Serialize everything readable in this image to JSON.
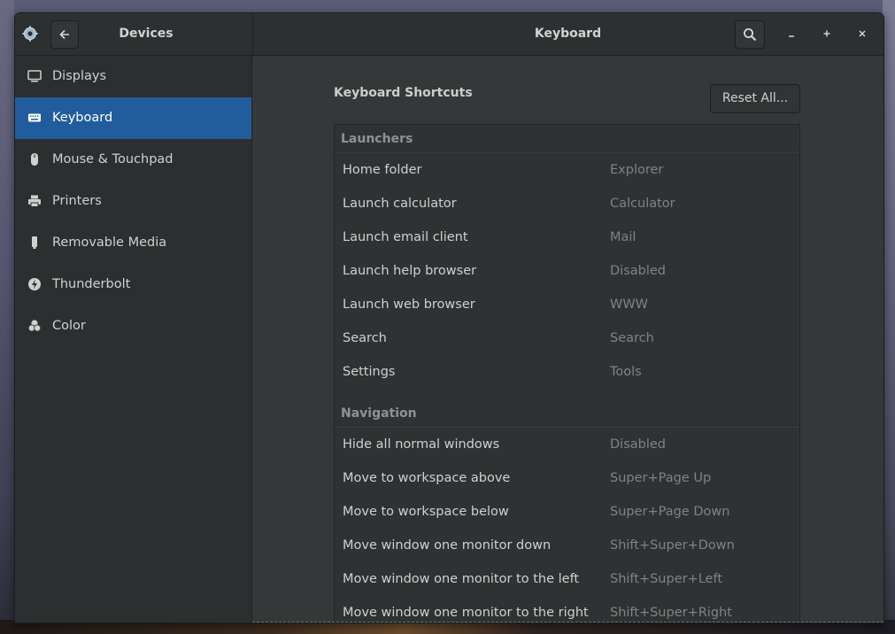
{
  "window": {
    "sidebar_title": "Devices",
    "title": "Keyboard"
  },
  "sidebar": {
    "items": [
      {
        "label": "Displays",
        "icon": "display-icon"
      },
      {
        "label": "Keyboard",
        "icon": "keyboard-icon",
        "active": true
      },
      {
        "label": "Mouse & Touchpad",
        "icon": "mouse-icon"
      },
      {
        "label": "Printers",
        "icon": "printer-icon"
      },
      {
        "label": "Removable Media",
        "icon": "usb-media-icon"
      },
      {
        "label": "Thunderbolt",
        "icon": "thunderbolt-icon"
      },
      {
        "label": "Color",
        "icon": "color-icon"
      }
    ]
  },
  "main": {
    "section_title": "Keyboard Shortcuts",
    "reset_label": "Reset All...",
    "groups": [
      {
        "name": "Launchers",
        "rows": [
          {
            "name": "Home folder",
            "accel": "Explorer"
          },
          {
            "name": "Launch calculator",
            "accel": "Calculator"
          },
          {
            "name": "Launch email client",
            "accel": "Mail"
          },
          {
            "name": "Launch help browser",
            "accel": "Disabled"
          },
          {
            "name": "Launch web browser",
            "accel": "WWW"
          },
          {
            "name": "Search",
            "accel": "Search"
          },
          {
            "name": "Settings",
            "accel": "Tools"
          }
        ]
      },
      {
        "name": "Navigation",
        "rows": [
          {
            "name": "Hide all normal windows",
            "accel": "Disabled"
          },
          {
            "name": "Move to workspace above",
            "accel": "Super+Page Up"
          },
          {
            "name": "Move to workspace below",
            "accel": "Super+Page Down"
          },
          {
            "name": "Move window one monitor down",
            "accel": "Shift+Super+Down"
          },
          {
            "name": "Move window one monitor to the left",
            "accel": "Shift+Super+Left"
          },
          {
            "name": "Move window one monitor to the right",
            "accel": "Shift+Super+Right"
          }
        ]
      }
    ]
  },
  "colors": {
    "accent": "#215d9c",
    "window_bg": "#353839",
    "headerbar_bg": "#2d3031"
  }
}
